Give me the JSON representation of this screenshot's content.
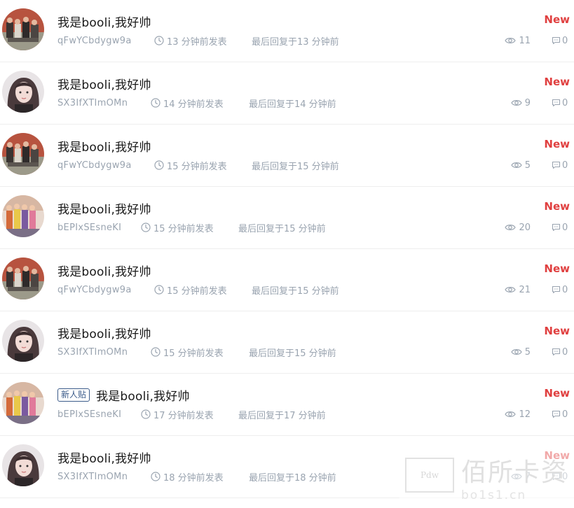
{
  "colors": {
    "new_badge": "#e04040",
    "meta_text": "#9aa4b0",
    "tag_border": "#3b5b8a"
  },
  "threads": [
    {
      "avatar": "avatar-group-photo",
      "tag": "",
      "title": "我是booli,我好帅",
      "author": "qFwYCbdygw9a",
      "posted": "13 分钟前发表",
      "last_reply": "最后回复于13 分钟前",
      "views": "11",
      "replies": "0",
      "badge": "New"
    },
    {
      "avatar": "avatar-girl-portrait",
      "tag": "",
      "title": "我是booli,我好帅",
      "author": "SX3IfXTImOMn",
      "posted": "14 分钟前发表",
      "last_reply": "最后回复于14 分钟前",
      "views": "9",
      "replies": "0",
      "badge": "New"
    },
    {
      "avatar": "avatar-group-photo",
      "tag": "",
      "title": "我是booli,我好帅",
      "author": "qFwYCbdygw9a",
      "posted": "15 分钟前发表",
      "last_reply": "最后回复于15 分钟前",
      "views": "5",
      "replies": "0",
      "badge": "New"
    },
    {
      "avatar": "avatar-colorful-group",
      "tag": "",
      "title": "我是booli,我好帅",
      "author": "bEPIxSEsneKI",
      "posted": "15 分钟前发表",
      "last_reply": "最后回复于15 分钟前",
      "views": "20",
      "replies": "0",
      "badge": "New"
    },
    {
      "avatar": "avatar-group-photo",
      "tag": "",
      "title": "我是booli,我好帅",
      "author": "qFwYCbdygw9a",
      "posted": "15 分钟前发表",
      "last_reply": "最后回复于15 分钟前",
      "views": "21",
      "replies": "0",
      "badge": "New"
    },
    {
      "avatar": "avatar-girl-portrait",
      "tag": "",
      "title": "我是booli,我好帅",
      "author": "SX3IfXTImOMn",
      "posted": "15 分钟前发表",
      "last_reply": "最后回复于15 分钟前",
      "views": "5",
      "replies": "0",
      "badge": "New"
    },
    {
      "avatar": "avatar-colorful-group",
      "tag": "新人贴",
      "title": "我是booli,我好帅",
      "author": "bEPIxSEsneKI",
      "posted": "17 分钟前发表",
      "last_reply": "最后回复于17 分钟前",
      "views": "12",
      "replies": "0",
      "badge": "New"
    },
    {
      "avatar": "avatar-girl-portrait",
      "tag": "",
      "title": "我是booli,我好帅",
      "author": "SX3IfXTImOMn",
      "posted": "18 分钟前发表",
      "last_reply": "最后回复于18 分钟前",
      "views": "7",
      "replies": "0",
      "badge": "New"
    }
  ],
  "watermark": {
    "logo": "Pdw",
    "text": "佰所卡资",
    "sub": "bo1s1.cn"
  }
}
